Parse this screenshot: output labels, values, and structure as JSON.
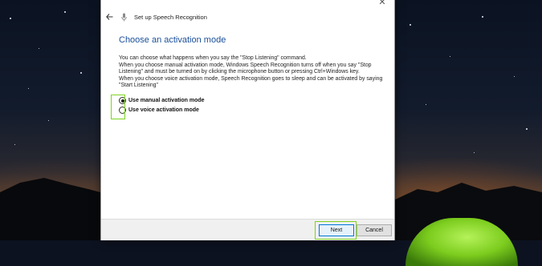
{
  "window": {
    "title": "Set up Speech Recognition",
    "close_glyph": "✕"
  },
  "content": {
    "heading": "Choose an activation mode",
    "paragraph1": "You can choose what happens when you say the \"Stop Listening\" command.",
    "paragraph2": "When you choose manual activation mode, Windows Speech Recognition turns off when you say \"Stop Listening\" and must be turned on by clicking the microphone button or pressing Ctrl+Windows key.",
    "paragraph3": "When you choose voice activation mode, Speech Recognition goes to sleep and can be activated by saying \"Start Listening\""
  },
  "options": {
    "manual": {
      "label": "Use manual activation mode",
      "selected": true
    },
    "voice": {
      "label": "Use voice activation mode",
      "selected": false
    }
  },
  "footer": {
    "next_label": "Next",
    "cancel_label": "Cancel"
  },
  "colors": {
    "heading": "#1a4f9a",
    "highlight": "#7ed321",
    "accent": "#0078d7"
  },
  "icons": [
    "close-icon",
    "back-arrow-icon",
    "microphone-icon"
  ]
}
